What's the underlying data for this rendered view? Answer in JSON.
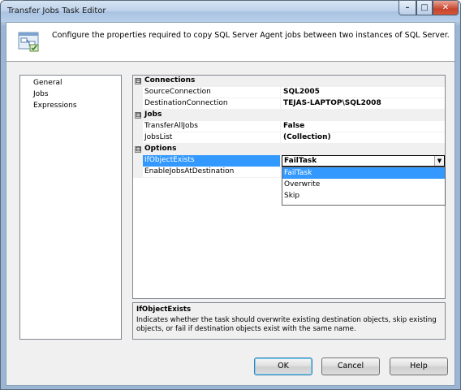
{
  "window": {
    "title": "Transfer Jobs Task Editor"
  },
  "header": {
    "description": "Configure the properties required to copy SQL Server Agent jobs between two instances of SQL Server."
  },
  "nav": {
    "items": [
      "General",
      "Jobs",
      "Expressions"
    ]
  },
  "grid": {
    "categories": {
      "connections": "Connections",
      "jobs": "Jobs",
      "options": "Options"
    },
    "props": {
      "source_connection": {
        "name": "SourceConnection",
        "value": "SQL2005"
      },
      "destination_connection": {
        "name": "DestinationConnection",
        "value": "TEJAS-LAPTOP\\SQL2008"
      },
      "transfer_all_jobs": {
        "name": "TransferAllJobs",
        "value": "False"
      },
      "jobs_list": {
        "name": "JobsList",
        "value": "(Collection)"
      },
      "if_object_exists": {
        "name": "IfObjectExists",
        "value": "FailTask"
      },
      "enable_jobs_at_destination": {
        "name": "EnableJobsAtDestination",
        "value": ""
      }
    },
    "dropdown_options": [
      "FailTask",
      "Overwrite",
      "Skip"
    ],
    "expander_symbol": "⊟"
  },
  "description_panel": {
    "title": "IfObjectExists",
    "text": "Indicates whether the task should overwrite existing destination objects, skip existing objects, or fail if destination objects exist with the same name."
  },
  "buttons": {
    "ok": "OK",
    "cancel": "Cancel",
    "help": "Help"
  },
  "titlebar_buttons": {
    "minimize": "–",
    "maximize": "□",
    "close": "✕"
  },
  "colors": {
    "selection": "#3399ff",
    "category_bg": "#f0f0f0"
  }
}
